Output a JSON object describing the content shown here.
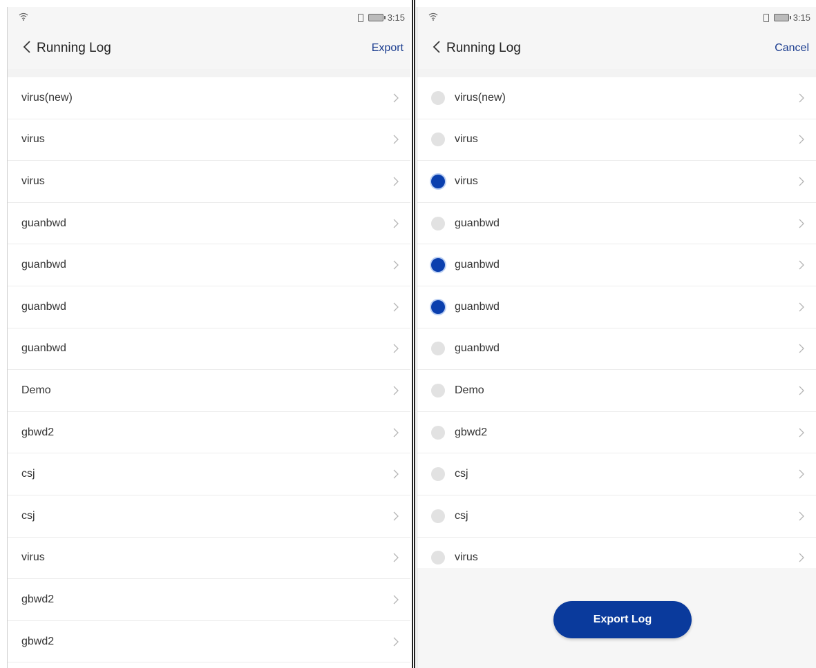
{
  "status_bar": {
    "time": "3:15"
  },
  "left_screen": {
    "title": "Running Log",
    "action_label": "Export",
    "items": [
      {
        "label": "virus(new)"
      },
      {
        "label": "virus"
      },
      {
        "label": "virus"
      },
      {
        "label": "guanbwd"
      },
      {
        "label": "guanbwd"
      },
      {
        "label": "guanbwd"
      },
      {
        "label": "guanbwd"
      },
      {
        "label": "Demo"
      },
      {
        "label": "gbwd2"
      },
      {
        "label": "csj"
      },
      {
        "label": "csj"
      },
      {
        "label": "virus"
      },
      {
        "label": "gbwd2"
      },
      {
        "label": "gbwd2"
      }
    ]
  },
  "right_screen": {
    "title": "Running Log",
    "action_label": "Cancel",
    "items": [
      {
        "label": "virus(new)",
        "selected": false
      },
      {
        "label": "virus",
        "selected": false
      },
      {
        "label": "virus",
        "selected": true
      },
      {
        "label": "guanbwd",
        "selected": false
      },
      {
        "label": "guanbwd",
        "selected": true
      },
      {
        "label": "guanbwd",
        "selected": true
      },
      {
        "label": "guanbwd",
        "selected": false
      },
      {
        "label": "Demo",
        "selected": false
      },
      {
        "label": "gbwd2",
        "selected": false
      },
      {
        "label": "csj",
        "selected": false
      },
      {
        "label": "csj",
        "selected": false
      },
      {
        "label": "virus",
        "selected": false
      }
    ],
    "export_button_label": "Export Log"
  },
  "colors": {
    "accent": "#0a3a9c",
    "radio_on": "#0a3fae",
    "radio_off": "#e2e2e2"
  },
  "icons": {
    "back": "chevron-left-icon",
    "row": "chevron-right-icon",
    "wifi": "wifi-icon",
    "battery": "battery-icon",
    "vibrate": "vibrate-icon"
  }
}
